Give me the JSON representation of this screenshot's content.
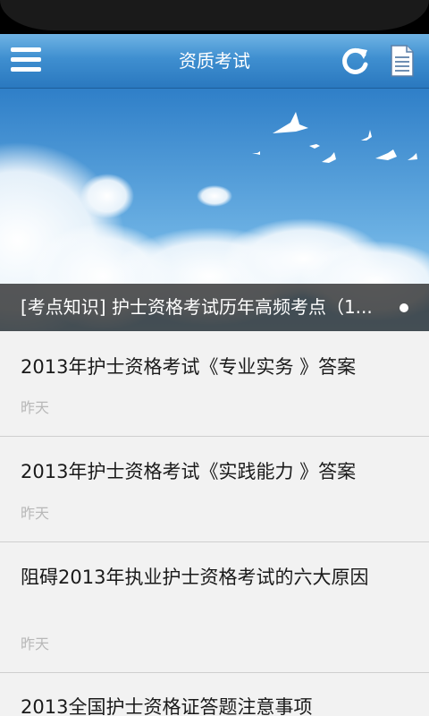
{
  "header": {
    "title": "资质考试"
  },
  "banner": {
    "caption": "[考点知识] 护士资格考试历年高频考点（1...",
    "colors": {
      "sky_top": "#2f7fc8",
      "sky_bottom": "#9fd0ee"
    }
  },
  "articles": [
    {
      "title": "2013年护士资格考试《专业实务 》答案",
      "date": "昨天"
    },
    {
      "title": "2013年护士资格考试《实践能力 》答案",
      "date": "昨天"
    },
    {
      "title": "阻碍2013年执业护士资格考试的六大原因",
      "date": "昨天"
    },
    {
      "title": "2013全国护士资格证答题注意事项",
      "date": ""
    }
  ],
  "icons": {
    "menu": "menu-icon",
    "refresh": "refresh-icon",
    "document": "document-icon"
  }
}
